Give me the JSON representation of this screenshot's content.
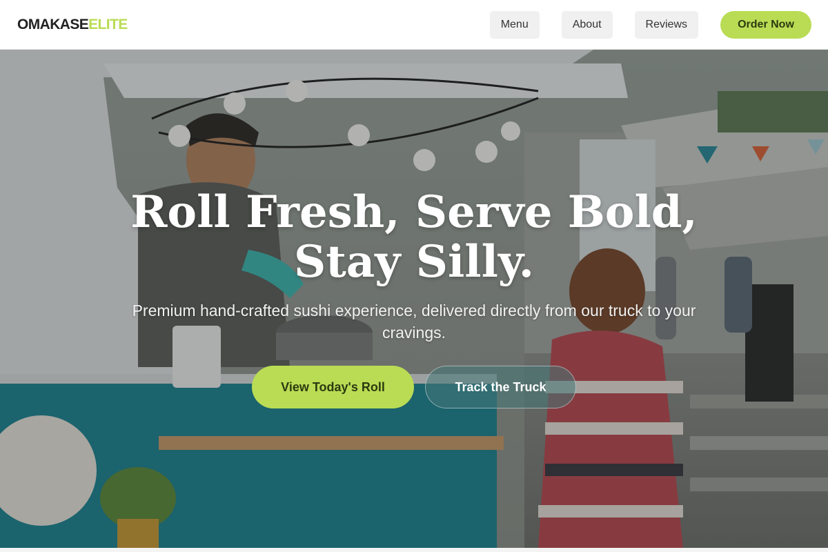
{
  "brand": {
    "logo_part1": "OMAKASE",
    "logo_part2": "ELITE",
    "accent_color": "#b9dc54"
  },
  "nav": {
    "items": [
      {
        "label": "Menu"
      },
      {
        "label": "About"
      },
      {
        "label": "Reviews"
      }
    ],
    "order_label": "Order Now"
  },
  "hero": {
    "title_line1": "Roll Fresh, Serve Bold,",
    "title_line2": "Stay Silly.",
    "subtitle": "Premium hand-crafted sushi experience, delivered directly from our truck to your cravings.",
    "primary_cta": "View Today's Roll",
    "secondary_cta": "Track the Truck",
    "background_image": "food-truck-photo"
  }
}
